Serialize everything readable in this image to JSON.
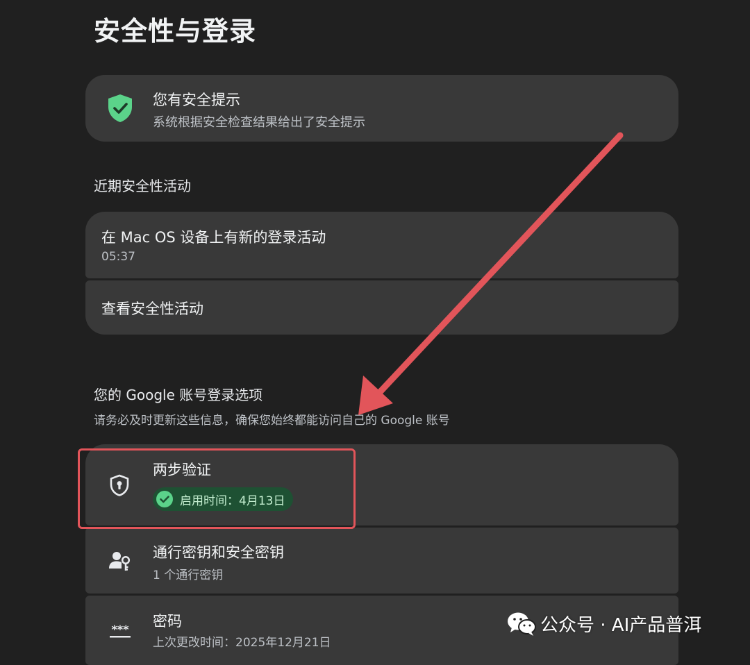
{
  "page": {
    "title": "安全性与登录"
  },
  "alert": {
    "title": "您有安全提示",
    "subtitle": "系统根据安全检查结果给出了安全提示",
    "icon": "shield-check-icon"
  },
  "recent_activity": {
    "heading": "近期安全性活动",
    "items": [
      {
        "title": "在 Mac OS 设备上有新的登录活动",
        "subtitle": "05:37"
      },
      {
        "title": "查看安全性活动"
      }
    ]
  },
  "signin_options": {
    "heading": "您的 Google 账号登录选项",
    "description": "请务必及时更新这些信息，确保您始终都能访问自己的 Google 账号",
    "items": [
      {
        "title": "两步验证",
        "badge": "启用时间：4月13日",
        "icon": "shield-keyhole-icon"
      },
      {
        "title": "通行密钥和安全密钥",
        "subtitle": "1 个通行密钥",
        "icon": "person-key-icon"
      },
      {
        "title": "密码",
        "subtitle": "上次更改时间：2025年12月21日",
        "icon": "password-dots-icon"
      }
    ]
  },
  "watermark": {
    "text": "公众号 · AI产品普洱",
    "icon": "wechat-icon"
  },
  "colors": {
    "background": "#202020",
    "card": "#393939",
    "annotation": "#e2555a",
    "success": "#5bd38a"
  }
}
